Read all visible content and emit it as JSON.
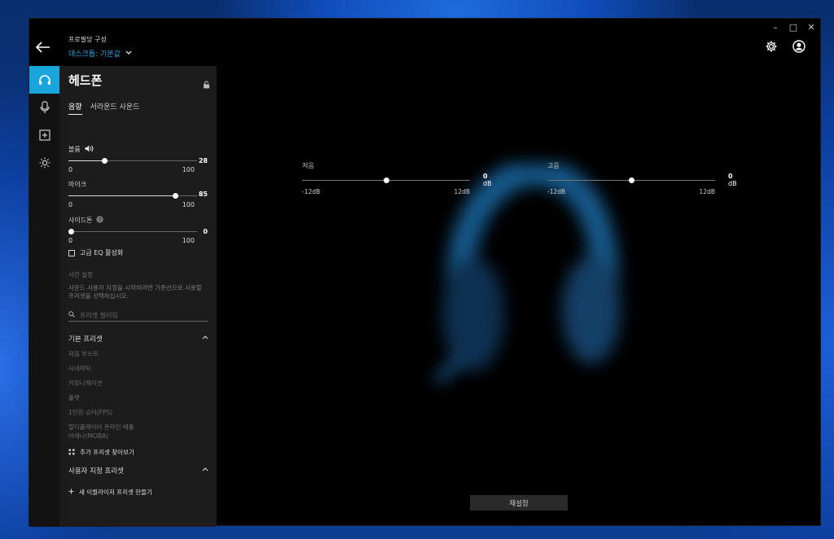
{
  "header": {
    "profile_label": "프로필당 구성",
    "profile_value": "데스크톱: 기본값"
  },
  "panel": {
    "title": "헤드폰",
    "tabs": [
      {
        "label": "음향",
        "active": true
      },
      {
        "label": "서라운드 사운드",
        "active": false
      }
    ],
    "volume": {
      "label": "볼륨",
      "value": "28",
      "min": "0",
      "max": "100"
    },
    "mic": {
      "label": "마이크",
      "value": "85",
      "min": "0",
      "max": "100"
    },
    "sidetone": {
      "label": "사이드톤",
      "value": "0",
      "min": "0",
      "max": "100"
    },
    "advanced_eq": "고급 EQ 활성화",
    "preset_title": "사전 설정",
    "preset_desc": "사운드 사용자 지정을 시작하려면 기준선으로 사용할 프리셋을 선택하십시오.",
    "filter_placeholder": "프리셋 필터링",
    "default_presets_label": "기본 프리셋",
    "default_presets": [
      "저음 부스트",
      "시네마틱",
      "커뮤니케이션",
      "플랫",
      "1인칭 슈터(FPS)",
      "멀티플레이어 온라인 배틀",
      "아레나(MOBA)"
    ],
    "more_presets": "추가 프리셋 찾아보기",
    "custom_presets_label": "사용자 지정 프리셋",
    "new_preset": "새 이퀄라이저 프리셋 만들기"
  },
  "eq": {
    "bass": {
      "label": "저음",
      "value": "0",
      "unit": "dB",
      "min": "-12dB",
      "max": "12dB"
    },
    "treble": {
      "label": "고음",
      "value": "0",
      "unit": "dB",
      "min": "-12dB",
      "max": "12dB"
    }
  },
  "reset_label": "재설정",
  "colors": {
    "accent": "#1aa6dd",
    "panel_bg": "#1c1c1c",
    "app_bg": "#000000"
  }
}
